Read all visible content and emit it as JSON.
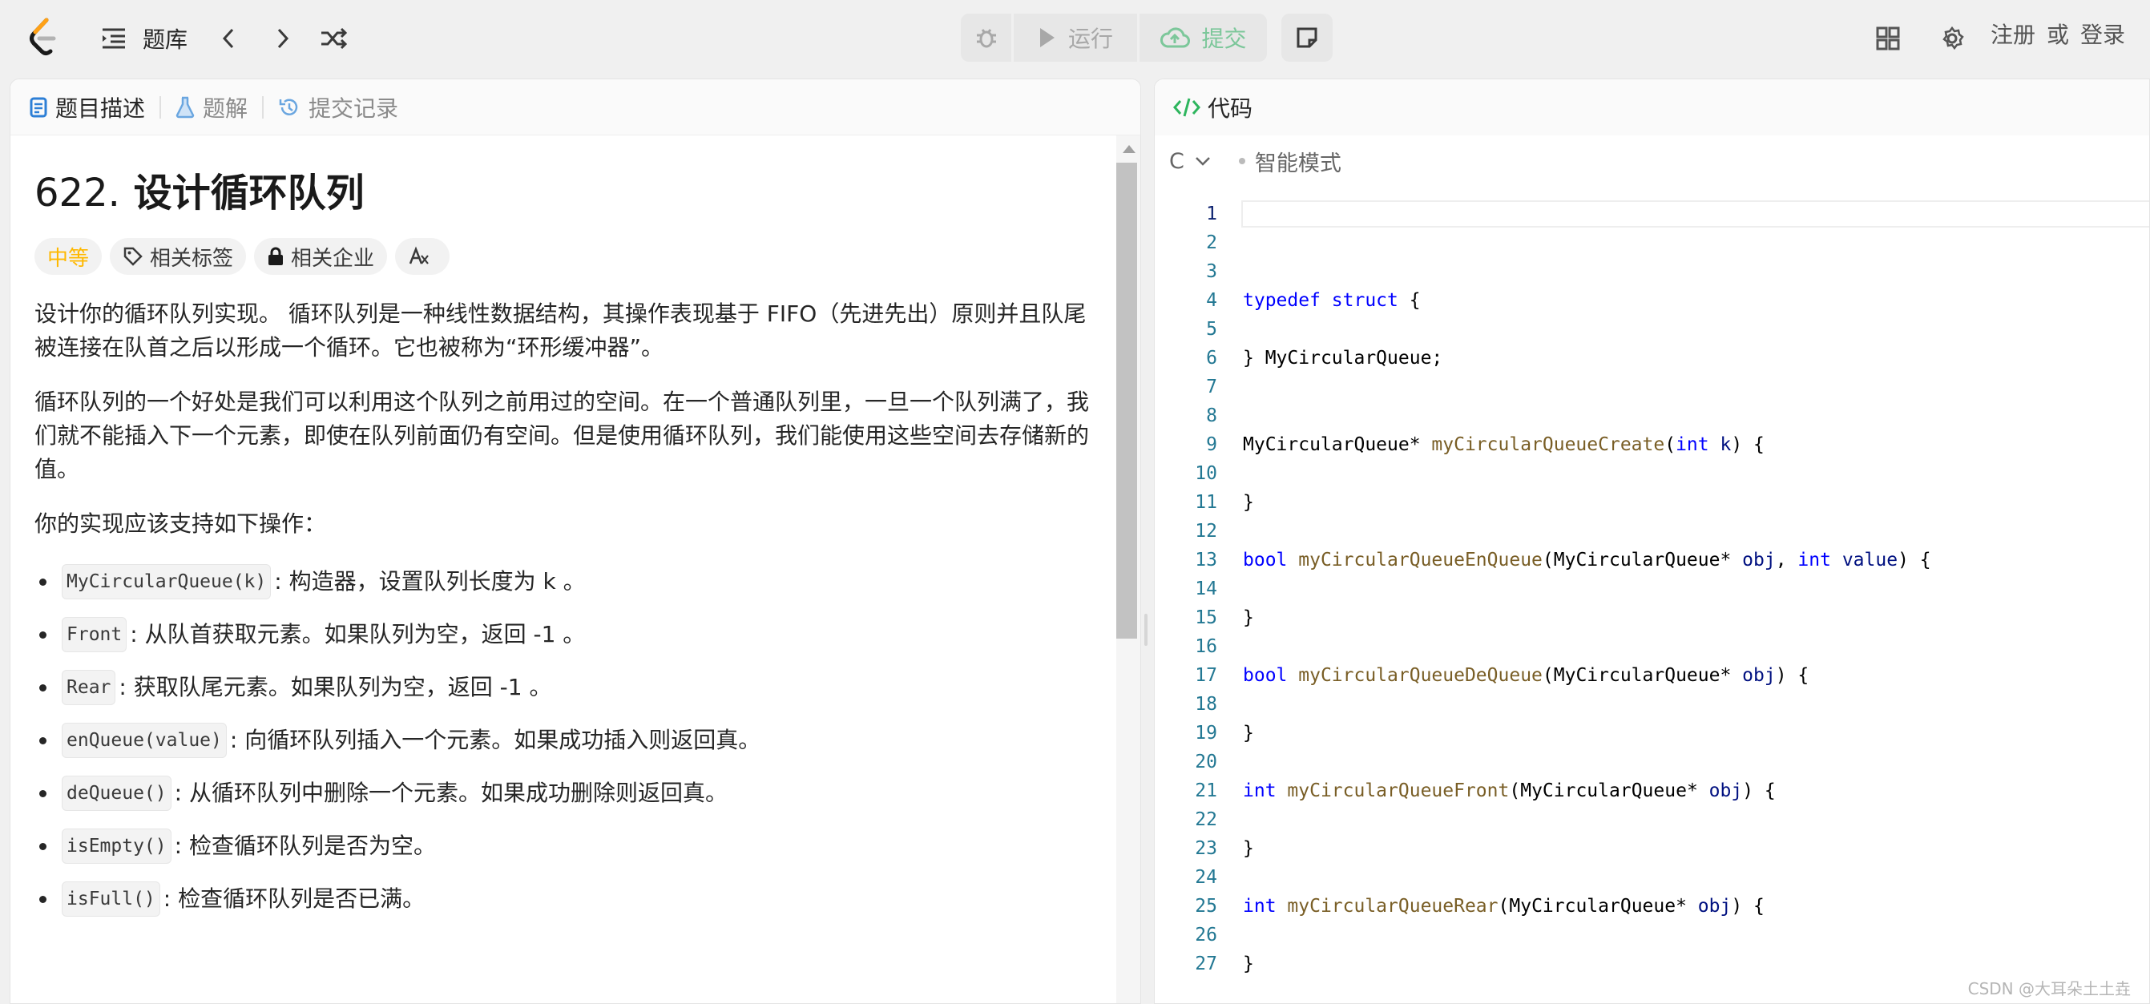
{
  "nav": {
    "problem_bank": "题库",
    "run": "运行",
    "submit": "提交",
    "register": "注册",
    "or": "或",
    "login": "登录",
    "icons": [
      "leetcode-logo",
      "list-icon",
      "chevron-left-icon",
      "chevron-right-icon",
      "shuffle-icon",
      "debug-icon",
      "play-icon",
      "cloud-upload-icon",
      "note-icon",
      "layout-icon",
      "gear-icon"
    ]
  },
  "left_tabs": {
    "description": "题目描述",
    "solutions": "题解",
    "submissions": "提交记录"
  },
  "problem": {
    "number": "622.",
    "title": "设计循环队列",
    "difficulty": "中等",
    "tag_related": "相关标签",
    "tag_company": "相关企业",
    "para1": "设计你的循环队列实现。 循环队列是一种线性数据结构，其操作表现基于 FIFO（先进先出）原则并且队尾被连接在队首之后以形成一个循环。它也被称为“环形缓冲器”。",
    "para2": "循环队列的一个好处是我们可以利用这个队列之前用过的空间。在一个普通队列里，一旦一个队列满了，我们就不能插入下一个元素，即使在队列前面仍有空间。但是使用循环队列，我们能使用这些空间去存储新的值。",
    "para3": "你的实现应该支持如下操作：",
    "ops": [
      {
        "code": "MyCircularQueue(k)",
        "text": ": 构造器，设置队列长度为 k 。"
      },
      {
        "code": "Front",
        "text": ": 从队首获取元素。如果队列为空，返回 -1 。"
      },
      {
        "code": "Rear",
        "text": ": 获取队尾元素。如果队列为空，返回 -1 。"
      },
      {
        "code": "enQueue(value)",
        "text": ": 向循环队列插入一个元素。如果成功插入则返回真。"
      },
      {
        "code": "deQueue()",
        "text": ": 从循环队列中删除一个元素。如果成功删除则返回真。"
      },
      {
        "code": "isEmpty()",
        "text": ": 检查循环队列是否为空。"
      },
      {
        "code": "isFull()",
        "text": ": 检查循环队列是否已满。"
      }
    ]
  },
  "editor": {
    "header": "代码",
    "language": "C",
    "mode": "智能模式",
    "lines": [
      {
        "n": "1",
        "t": ""
      },
      {
        "n": "2",
        "t": ""
      },
      {
        "n": "3",
        "t": ""
      },
      {
        "n": "4",
        "t": "typedef struct {"
      },
      {
        "n": "5",
        "t": ""
      },
      {
        "n": "6",
        "t": "} MyCircularQueue;"
      },
      {
        "n": "7",
        "t": ""
      },
      {
        "n": "8",
        "t": ""
      },
      {
        "n": "9",
        "t": "MyCircularQueue* myCircularQueueCreate(int k) {"
      },
      {
        "n": "10",
        "t": ""
      },
      {
        "n": "11",
        "t": "}"
      },
      {
        "n": "12",
        "t": ""
      },
      {
        "n": "13",
        "t": "bool myCircularQueueEnQueue(MyCircularQueue* obj, int value) {"
      },
      {
        "n": "14",
        "t": ""
      },
      {
        "n": "15",
        "t": "}"
      },
      {
        "n": "16",
        "t": ""
      },
      {
        "n": "17",
        "t": "bool myCircularQueueDeQueue(MyCircularQueue* obj) {"
      },
      {
        "n": "18",
        "t": ""
      },
      {
        "n": "19",
        "t": "}"
      },
      {
        "n": "20",
        "t": ""
      },
      {
        "n": "21",
        "t": "int myCircularQueueFront(MyCircularQueue* obj) {"
      },
      {
        "n": "22",
        "t": ""
      },
      {
        "n": "23",
        "t": "}"
      },
      {
        "n": "24",
        "t": ""
      },
      {
        "n": "25",
        "t": "int myCircularQueueRear(MyCircularQueue* obj) {"
      },
      {
        "n": "26",
        "t": ""
      },
      {
        "n": "27",
        "t": "}"
      }
    ]
  },
  "watermark": "CSDN @大耳朵土土垚",
  "colors": {
    "submit_green": "#7cc79a",
    "difficulty": "#ffb800",
    "accent_blue": "#0000ff"
  }
}
